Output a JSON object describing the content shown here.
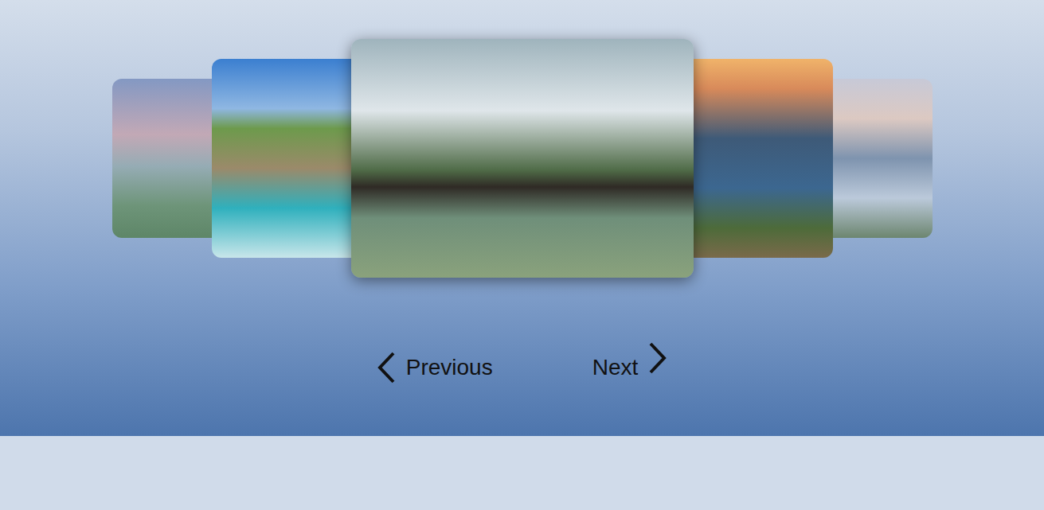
{
  "carousel": {
    "slides": [
      {
        "selected": false
      },
      {
        "selected": false
      },
      {
        "selected": true
      },
      {
        "selected": false
      },
      {
        "selected": false
      }
    ]
  },
  "controls": {
    "previous": {
      "label": "Previous"
    },
    "next": {
      "label": "Next"
    }
  }
}
